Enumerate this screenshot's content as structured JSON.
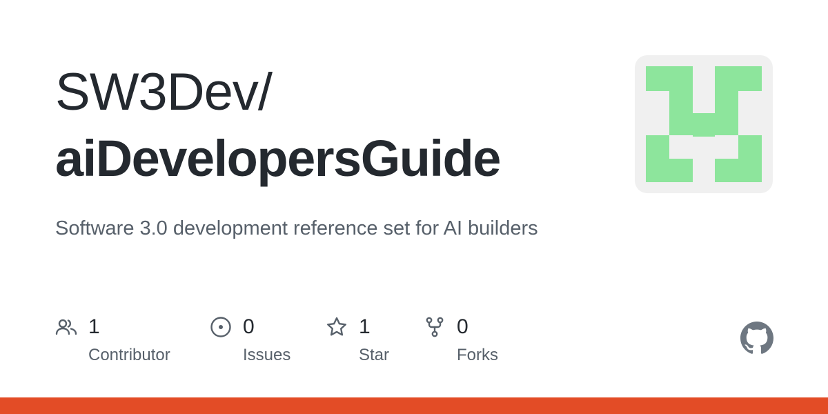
{
  "repo": {
    "owner": "SW3Dev/",
    "name": "aiDevelopersGuide",
    "description": "Software 3.0 development reference set for AI builders"
  },
  "stats": {
    "contributors": {
      "count": "1",
      "label": "Contributor",
      "icon": "people-icon"
    },
    "issues": {
      "count": "0",
      "label": "Issues",
      "icon": "issue-opened-icon"
    },
    "stars": {
      "count": "1",
      "label": "Star",
      "icon": "star-icon"
    },
    "forks": {
      "count": "0",
      "label": "Forks",
      "icon": "repo-forked-icon"
    }
  },
  "colors": {
    "title": "#24292f",
    "muted": "#57606a",
    "avatar_fill": "#8de59c",
    "avatar_bg": "#f0f0f0",
    "language_bar": "#e34c26",
    "github_mark": "#6e7781"
  }
}
